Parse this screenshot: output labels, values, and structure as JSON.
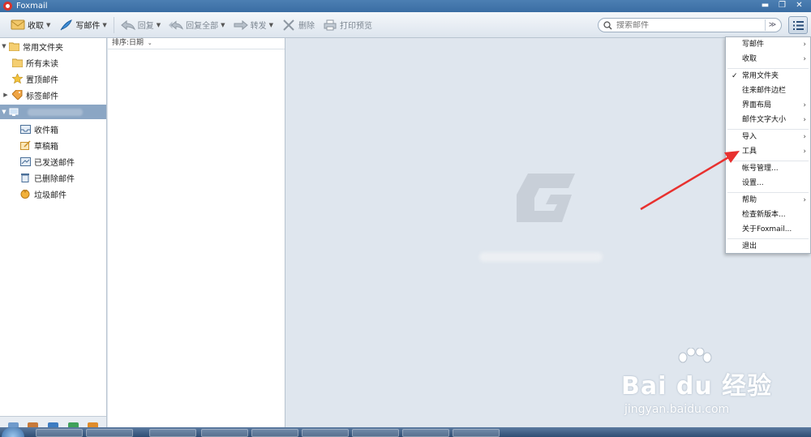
{
  "window": {
    "title": "Foxmail"
  },
  "toolbar": {
    "receive": "收取",
    "compose": "写邮件",
    "reply": "回复",
    "reply_all": "回复全部",
    "forward": "转发",
    "delete": "删除",
    "print_preview": "打印预览"
  },
  "search": {
    "placeholder": "搜索邮件"
  },
  "sidebar": {
    "common_folders": "常用文件夹",
    "all_unread": "所有未读",
    "pinned": "置顶邮件",
    "tagged": "标签邮件",
    "inbox": "收件箱",
    "drafts": "草稿箱",
    "sent": "已发送邮件",
    "deleted": "已删除邮件",
    "junk": "垃圾邮件"
  },
  "msglist": {
    "sort_label": "排序:日期"
  },
  "menu": {
    "compose": "写邮件",
    "receive": "收取",
    "common_folders": "常用文件夹",
    "contacts_sidebar": "往来邮件边栏",
    "layout": "界面布局",
    "font_size": "邮件文字大小",
    "import": "导入",
    "tools": "工具",
    "account_mgmt": "帐号管理...",
    "settings": "设置...",
    "help": "帮助",
    "check_update": "检查新版本...",
    "about": "关于Foxmail...",
    "exit": "退出"
  },
  "watermark": {
    "brand": "Bai du 经验",
    "url": "jingyan.baidu.com"
  },
  "colors": {
    "accent": "#3a6da3",
    "arrow": "#e8312f"
  }
}
